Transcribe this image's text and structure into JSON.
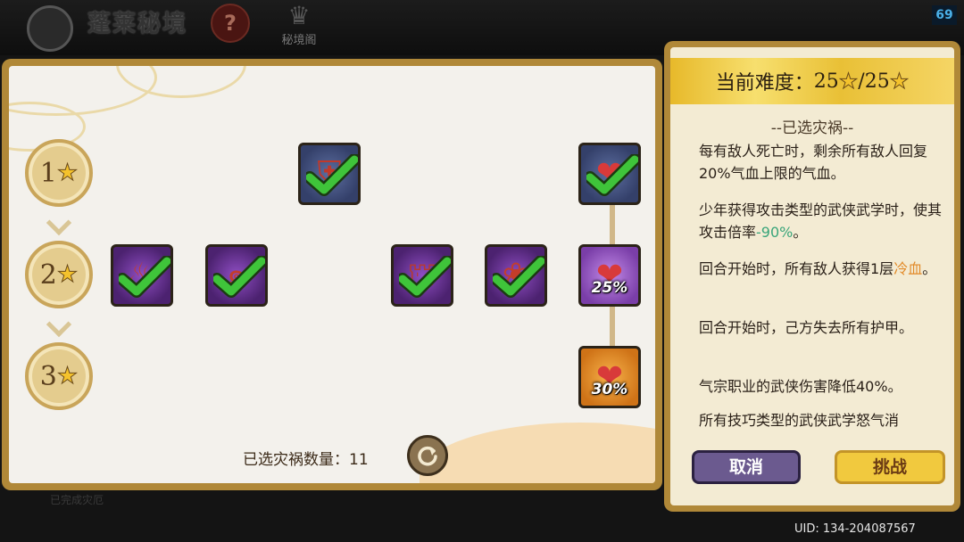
{
  "topbar": {
    "title": "蓬莱秘境",
    "help_icon": "?",
    "shop_label": "秘境阁",
    "fps": "69"
  },
  "levels": [
    {
      "num": "1",
      "star": "★"
    },
    {
      "num": "2",
      "star": "★"
    },
    {
      "num": "3",
      "star": "★"
    }
  ],
  "nodes": [
    {
      "name": "node-shield",
      "color": "blue",
      "motif": "shield",
      "checked": true,
      "percent": ""
    },
    {
      "name": "node-heart-top",
      "color": "blue",
      "motif": "heart",
      "checked": true,
      "percent": ""
    },
    {
      "name": "node-flame-1",
      "color": "purple",
      "motif": "flame",
      "checked": true,
      "percent": ""
    },
    {
      "name": "node-swirl",
      "color": "purple",
      "motif": "swirl",
      "checked": true,
      "percent": ""
    },
    {
      "name": "node-armor",
      "color": "purple",
      "motif": "armor",
      "checked": true,
      "percent": ""
    },
    {
      "name": "node-lotus",
      "color": "purple",
      "motif": "lotus",
      "checked": true,
      "percent": ""
    },
    {
      "name": "node-heart-25",
      "color": "lpurple",
      "motif": "heart",
      "checked": false,
      "percent": "25%"
    },
    {
      "name": "node-heart-30",
      "color": "orange",
      "motif": "heart",
      "checked": false,
      "percent": "30%"
    }
  ],
  "disaster_count": {
    "label": "已选灾祸数量：",
    "value": "11"
  },
  "below_text": "已完成灾厄",
  "right_panel": {
    "difficulty_label": "当前难度：",
    "difficulty_current": "25",
    "difficulty_max": "25",
    "difficulty_sep": "/",
    "star": "★",
    "selected_header": "--已选灾祸--",
    "descriptions": [
      {
        "parts": [
          {
            "t": "每有敌人死亡时，剩余所有敌人回复20%气血上限的气血。",
            "c": ""
          }
        ]
      },
      {
        "parts": [
          {
            "t": "少年获得攻击类型的武侠武学时，使其攻击倍率",
            "c": ""
          },
          {
            "t": "-90%",
            "c": "green"
          },
          {
            "t": "。",
            "c": ""
          }
        ]
      },
      {
        "parts": [
          {
            "t": "回合开始时，所有敌人获得1层",
            "c": ""
          },
          {
            "t": "冷血",
            "c": "orange"
          },
          {
            "t": "。",
            "c": ""
          }
        ]
      },
      {
        "parts": [
          {
            "t": "回合开始时，己方失去所有护甲。",
            "c": ""
          }
        ]
      },
      {
        "parts": [
          {
            "t": "气宗职业的武侠伤害降低40%。",
            "c": ""
          }
        ]
      },
      {
        "parts": [
          {
            "t": "所有技巧类型的武侠武学怒气消",
            "c": ""
          }
        ]
      }
    ],
    "cancel_label": "取消",
    "challenge_label": "挑战"
  },
  "uid": "UID: 134-204087567",
  "colors": {
    "gold_frame": "#b08838",
    "check_green": "#3fc43a",
    "cancel_purple": "#6b5a8f",
    "challenge_yellow": "#f1c93e"
  }
}
